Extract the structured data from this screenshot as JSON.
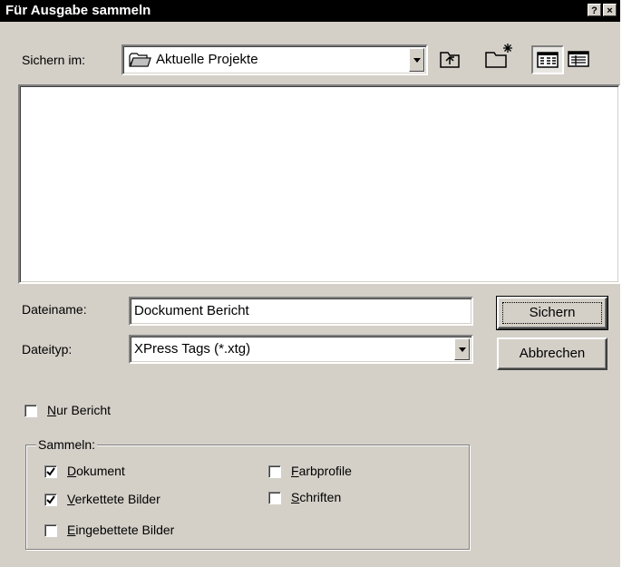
{
  "dialog": {
    "title": "Für Ausgabe sammeln",
    "help_glyph": "?",
    "close_glyph": "×"
  },
  "save_in": {
    "label": "Sichern im:",
    "value": "Aktuelle Projekte"
  },
  "toolbar": {
    "up_icon": "up-one-level-icon",
    "new_folder_icon": "new-folder-icon",
    "list_view_icon": "list-view-icon",
    "details_view_icon": "details-view-icon"
  },
  "filename": {
    "label": "Dateiname:",
    "value": "Dockument Bericht"
  },
  "filetype": {
    "label": "Dateityp:",
    "value": "XPress Tags (*.xtg)"
  },
  "buttons": {
    "save": "Sichern",
    "cancel": "Abbrechen"
  },
  "only_report": {
    "mnemonic": "N",
    "rest": "ur Bericht",
    "checked": false
  },
  "collect": {
    "legend": "Sammeln:",
    "items": [
      {
        "mnemonic": "D",
        "rest": "okument",
        "checked": true
      },
      {
        "mnemonic": "V",
        "rest": "erkettete Bilder",
        "checked": true
      },
      {
        "mnemonic": "E",
        "rest": "ingebettete Bilder",
        "checked": false
      },
      {
        "mnemonic": "F",
        "rest": "arbprofile",
        "checked": false
      },
      {
        "mnemonic": "S",
        "rest": "chriften",
        "checked": false
      }
    ]
  }
}
